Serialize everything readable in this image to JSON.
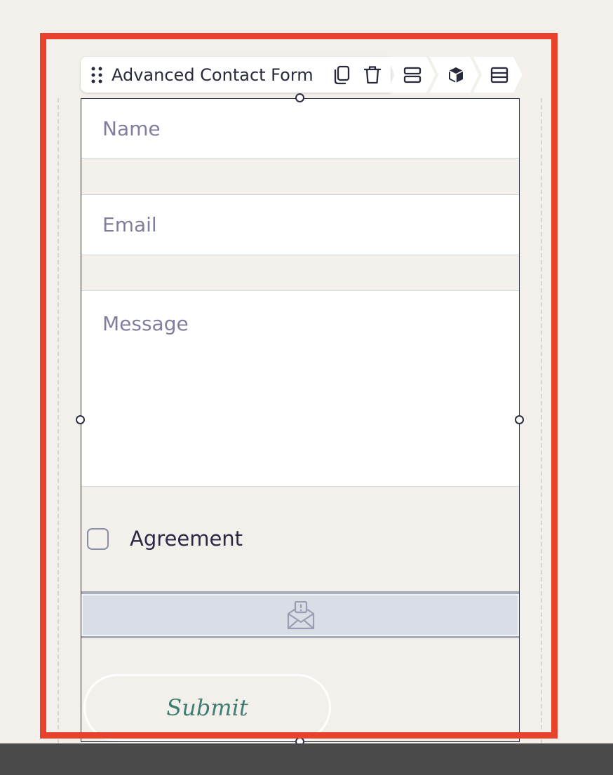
{
  "toolbar": {
    "block_title": "Advanced Contact Form",
    "icons": [
      "drag-handle-icon",
      "duplicate-icon",
      "trash-icon",
      "rows-icon",
      "cube-icon",
      "layout-icon"
    ]
  },
  "form": {
    "name_placeholder": "Name",
    "email_placeholder": "Email",
    "message_placeholder": "Message",
    "agreement_label": "Agreement",
    "submit_label": "Submit"
  },
  "colors": {
    "selection": "#e8412c",
    "submit_text": "#3f7e73",
    "placeholder": "#7f7f9d",
    "bottom_bar": "#4a4a4a"
  }
}
